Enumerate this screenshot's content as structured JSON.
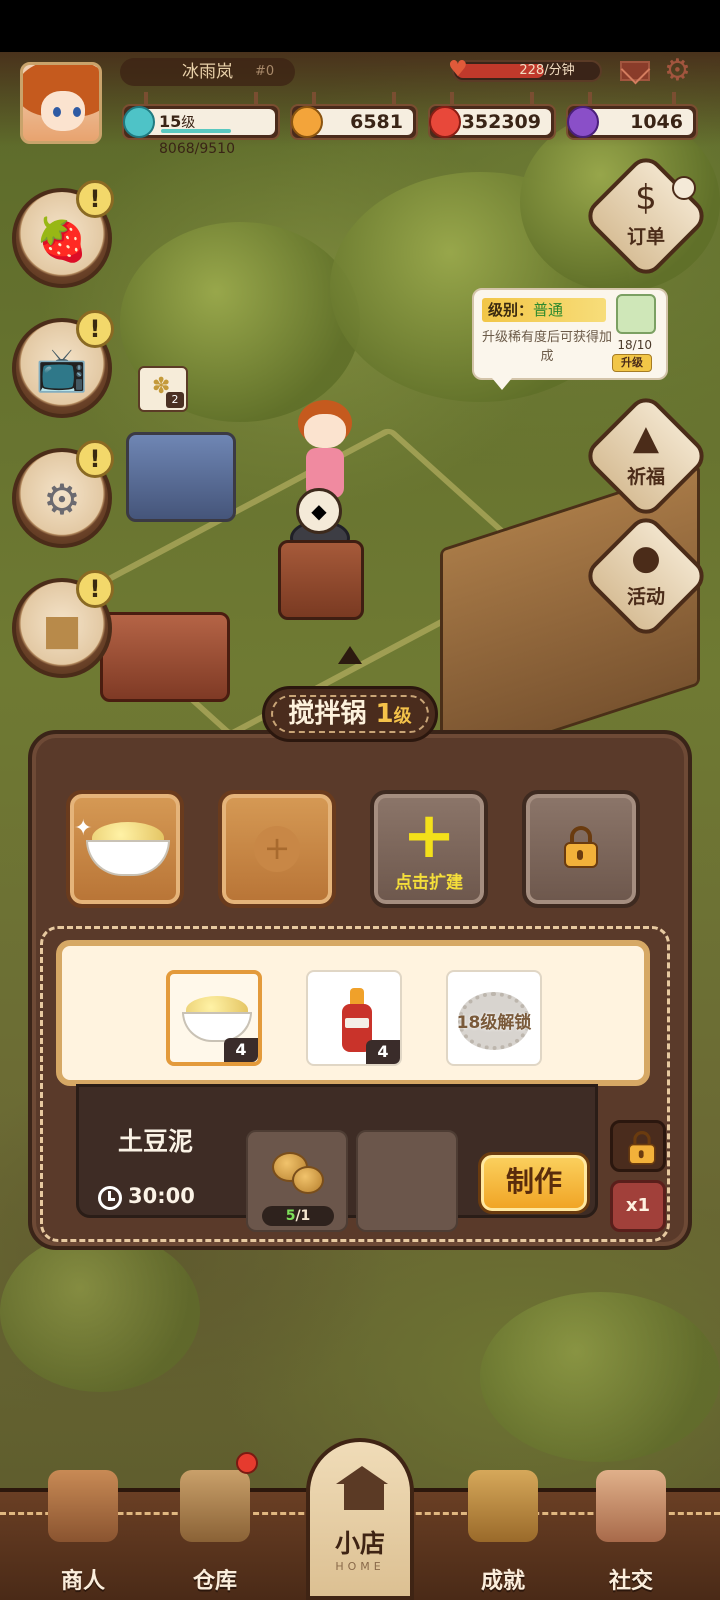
{
  "player": {
    "name": "冰雨岚",
    "id_mark": "#0",
    "level": "15",
    "level_unit": "级",
    "xp": "8068/9510",
    "rate": "228/分钟",
    "rate_fraction": 0.6
  },
  "resources": {
    "coins": "6581",
    "hearts": "352309",
    "gems": "1046"
  },
  "side_left": [
    {
      "name": "strawberry",
      "icon": "strawberry-icon"
    },
    {
      "name": "tv",
      "icon": "tv-icon"
    },
    {
      "name": "machine",
      "icon": "machine-icon"
    },
    {
      "name": "sofa",
      "icon": "sofa-icon"
    }
  ],
  "side_right": {
    "orders": "订单",
    "pray": "祈福",
    "events": "活动"
  },
  "tooltip": {
    "level_label": "级别：",
    "level_value": "普通",
    "body": "升级稀有度后可获得加成",
    "count": "18/10",
    "upgrade": "升级"
  },
  "wheat_badge": {
    "count": "2"
  },
  "panel": {
    "title": "搅拌锅",
    "level": "1",
    "level_unit": "级",
    "expand_label": "点击扩建",
    "ingredients": [
      {
        "name": "mashed-potato",
        "count": "4"
      },
      {
        "name": "ketchup",
        "count": "4"
      },
      {
        "name": "locked",
        "label": "18级解锁"
      }
    ],
    "recipe_name": "土豆泥",
    "timer": "30:00",
    "material_progress_have": "5",
    "material_progress_need": "/1",
    "make_button": "制作",
    "multiplier": "x1"
  },
  "bottom_nav": {
    "merchant": "商人",
    "warehouse": "仓库",
    "home": "小店",
    "home_sub": "HOME",
    "achievements": "成就",
    "social": "社交"
  },
  "colors": {
    "panel_bg": "#5a3a2a",
    "accent_yellow": "#f4c24a",
    "make_button": "#f0a222",
    "progress_green": "#7ee05a"
  }
}
